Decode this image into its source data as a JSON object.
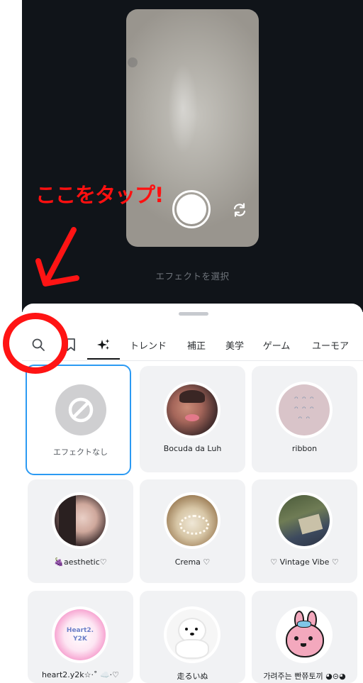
{
  "camera": {
    "select_effect_label": "エフェクトを選択",
    "shutter": "shutter-button",
    "flip": "flip-camera-icon"
  },
  "annotation": {
    "text": "ここをタップ!",
    "color": "#ff1010"
  },
  "tabs": [
    {
      "label": "search-icon",
      "type": "icon"
    },
    {
      "label": "bookmark-icon",
      "type": "icon"
    },
    {
      "label": "sparkle-icon",
      "type": "icon",
      "selected": true
    },
    {
      "label": "トレンド"
    },
    {
      "label": "補正"
    },
    {
      "label": "美学"
    },
    {
      "label": "ゲーム"
    },
    {
      "label": "ユーモア"
    }
  ],
  "effects": [
    {
      "label": "エフェクトなし",
      "selected": true
    },
    {
      "label": "Bocuda da Luh"
    },
    {
      "label": "ribbon"
    },
    {
      "label": "🍇aesthetic♡"
    },
    {
      "label": "Crema ♡"
    },
    {
      "label": "♡ Vintage Vibe ♡"
    },
    {
      "label": "heart2.y2k☆·˚ ☁️·♡"
    },
    {
      "label": "走るいぬ"
    },
    {
      "label": "가려주는 빤쮸토끼 ◕⊝◕"
    }
  ],
  "thumb_text": {
    "heart_line1": "Heart2.",
    "heart_line2": "Y2K"
  },
  "colors": {
    "accent_blue": "#2b9af3",
    "camera_bg": "#101419",
    "card_bg": "#f1f2f4"
  }
}
